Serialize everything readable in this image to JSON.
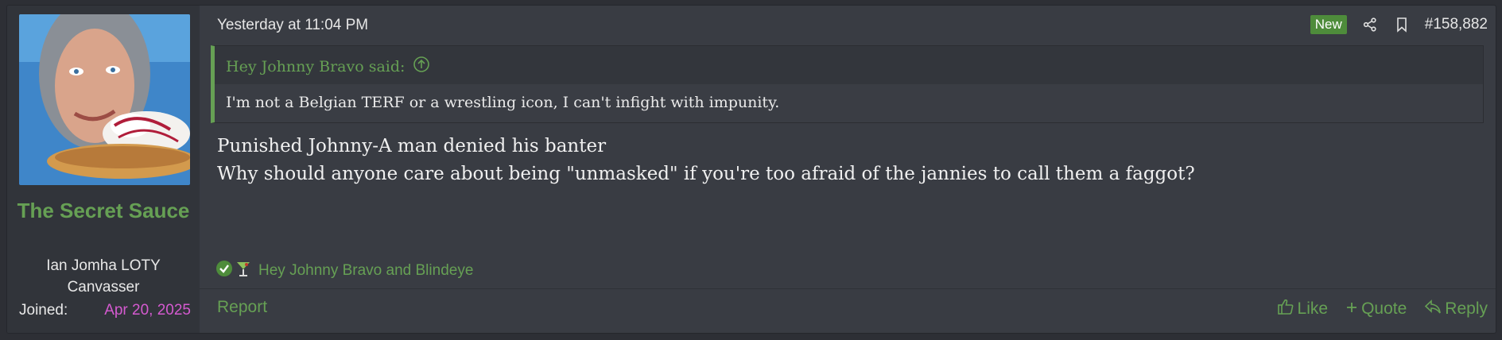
{
  "user": {
    "name": "The Secret Sauce",
    "title_line1": "Ian Jomha LOTY",
    "title_line2": "Canvasser",
    "joined_label": "Joined:",
    "joined_value": "Apr 20, 2025"
  },
  "post": {
    "date": "Yesterday at 11:04 PM",
    "new_badge": "New",
    "number": "#158,882",
    "quote": {
      "author": "Hey Johnny Bravo said:",
      "text": "I'm not a Belgian TERF or a wrestling icon, I can't infight with impunity."
    },
    "lines": [
      "Punished Johnny-A man denied his banter",
      "Why should anyone care about being \"unmasked\" if you're too afraid of the jannies to call them a faggot?"
    ],
    "reactions": {
      "icons": [
        "checkmark-reaction-icon",
        "cocktail-reaction-icon"
      ],
      "names": "Hey Johnny Bravo and Blindeye"
    },
    "report_label": "Report",
    "like_label": "Like",
    "quote_label": "Quote",
    "reply_label": "Reply"
  },
  "colors": {
    "accent": "#66a054",
    "joined_date": "#d55ad0",
    "new_badge": "#4e8c3b",
    "background": "#393c43"
  }
}
